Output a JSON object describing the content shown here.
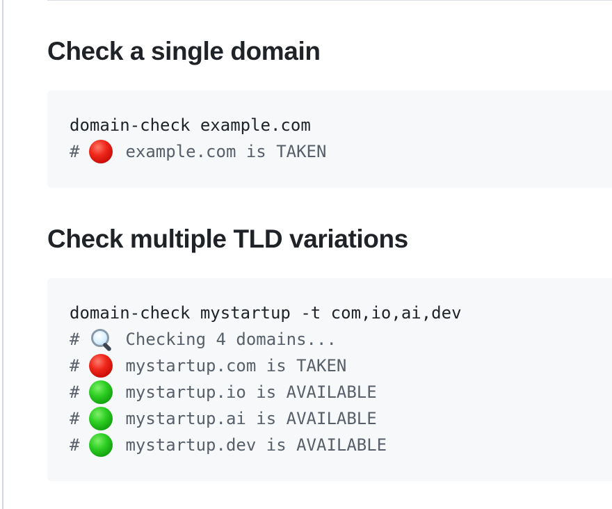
{
  "sections": [
    {
      "title": "Check a single domain",
      "lines": [
        {
          "kind": "command",
          "text": "domain-check example.com"
        },
        {
          "kind": "comment",
          "prefix": "#",
          "icon": "red-circle-icon",
          "text": "example.com is TAKEN"
        }
      ]
    },
    {
      "title": "Check multiple TLD variations",
      "lines": [
        {
          "kind": "command",
          "text": "domain-check mystartup -t com,io,ai,dev"
        },
        {
          "kind": "comment",
          "prefix": "#",
          "icon": "magnifying-glass-icon",
          "text": "Checking 4 domains..."
        },
        {
          "kind": "comment",
          "prefix": "#",
          "icon": "red-circle-icon",
          "text": "mystartup.com is TAKEN"
        },
        {
          "kind": "comment",
          "prefix": "#",
          "icon": "green-circle-icon",
          "text": "mystartup.io is AVAILABLE"
        },
        {
          "kind": "comment",
          "prefix": "#",
          "icon": "green-circle-icon",
          "text": "mystartup.ai is AVAILABLE"
        },
        {
          "kind": "comment",
          "prefix": "#",
          "icon": "green-circle-icon",
          "text": "mystartup.dev is AVAILABLE"
        }
      ]
    }
  ],
  "colors": {
    "heading": "#1f2328",
    "code_text": "#1f2328",
    "comment_text": "#57606a",
    "code_background": "#f6f8fa",
    "taken": "#e0281c",
    "available": "#20b518"
  }
}
